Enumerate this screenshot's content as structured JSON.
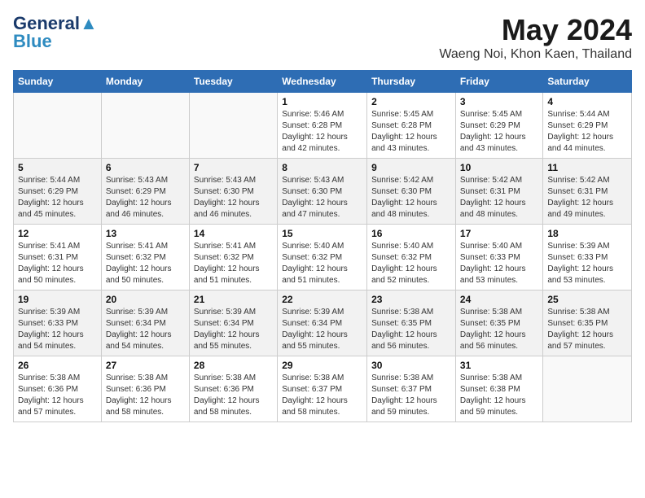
{
  "header": {
    "logo_line1": "General",
    "logo_line2": "Blue",
    "main_title": "May 2024",
    "subtitle": "Waeng Noi, Khon Kaen, Thailand"
  },
  "weekdays": [
    "Sunday",
    "Monday",
    "Tuesday",
    "Wednesday",
    "Thursday",
    "Friday",
    "Saturday"
  ],
  "weeks": [
    [
      {
        "day": "",
        "info": ""
      },
      {
        "day": "",
        "info": ""
      },
      {
        "day": "",
        "info": ""
      },
      {
        "day": "1",
        "info": "Sunrise: 5:46 AM\nSunset: 6:28 PM\nDaylight: 12 hours\nand 42 minutes."
      },
      {
        "day": "2",
        "info": "Sunrise: 5:45 AM\nSunset: 6:28 PM\nDaylight: 12 hours\nand 43 minutes."
      },
      {
        "day": "3",
        "info": "Sunrise: 5:45 AM\nSunset: 6:29 PM\nDaylight: 12 hours\nand 43 minutes."
      },
      {
        "day": "4",
        "info": "Sunrise: 5:44 AM\nSunset: 6:29 PM\nDaylight: 12 hours\nand 44 minutes."
      }
    ],
    [
      {
        "day": "5",
        "info": "Sunrise: 5:44 AM\nSunset: 6:29 PM\nDaylight: 12 hours\nand 45 minutes."
      },
      {
        "day": "6",
        "info": "Sunrise: 5:43 AM\nSunset: 6:29 PM\nDaylight: 12 hours\nand 46 minutes."
      },
      {
        "day": "7",
        "info": "Sunrise: 5:43 AM\nSunset: 6:30 PM\nDaylight: 12 hours\nand 46 minutes."
      },
      {
        "day": "8",
        "info": "Sunrise: 5:43 AM\nSunset: 6:30 PM\nDaylight: 12 hours\nand 47 minutes."
      },
      {
        "day": "9",
        "info": "Sunrise: 5:42 AM\nSunset: 6:30 PM\nDaylight: 12 hours\nand 48 minutes."
      },
      {
        "day": "10",
        "info": "Sunrise: 5:42 AM\nSunset: 6:31 PM\nDaylight: 12 hours\nand 48 minutes."
      },
      {
        "day": "11",
        "info": "Sunrise: 5:42 AM\nSunset: 6:31 PM\nDaylight: 12 hours\nand 49 minutes."
      }
    ],
    [
      {
        "day": "12",
        "info": "Sunrise: 5:41 AM\nSunset: 6:31 PM\nDaylight: 12 hours\nand 50 minutes."
      },
      {
        "day": "13",
        "info": "Sunrise: 5:41 AM\nSunset: 6:32 PM\nDaylight: 12 hours\nand 50 minutes."
      },
      {
        "day": "14",
        "info": "Sunrise: 5:41 AM\nSunset: 6:32 PM\nDaylight: 12 hours\nand 51 minutes."
      },
      {
        "day": "15",
        "info": "Sunrise: 5:40 AM\nSunset: 6:32 PM\nDaylight: 12 hours\nand 51 minutes."
      },
      {
        "day": "16",
        "info": "Sunrise: 5:40 AM\nSunset: 6:32 PM\nDaylight: 12 hours\nand 52 minutes."
      },
      {
        "day": "17",
        "info": "Sunrise: 5:40 AM\nSunset: 6:33 PM\nDaylight: 12 hours\nand 53 minutes."
      },
      {
        "day": "18",
        "info": "Sunrise: 5:39 AM\nSunset: 6:33 PM\nDaylight: 12 hours\nand 53 minutes."
      }
    ],
    [
      {
        "day": "19",
        "info": "Sunrise: 5:39 AM\nSunset: 6:33 PM\nDaylight: 12 hours\nand 54 minutes."
      },
      {
        "day": "20",
        "info": "Sunrise: 5:39 AM\nSunset: 6:34 PM\nDaylight: 12 hours\nand 54 minutes."
      },
      {
        "day": "21",
        "info": "Sunrise: 5:39 AM\nSunset: 6:34 PM\nDaylight: 12 hours\nand 55 minutes."
      },
      {
        "day": "22",
        "info": "Sunrise: 5:39 AM\nSunset: 6:34 PM\nDaylight: 12 hours\nand 55 minutes."
      },
      {
        "day": "23",
        "info": "Sunrise: 5:38 AM\nSunset: 6:35 PM\nDaylight: 12 hours\nand 56 minutes."
      },
      {
        "day": "24",
        "info": "Sunrise: 5:38 AM\nSunset: 6:35 PM\nDaylight: 12 hours\nand 56 minutes."
      },
      {
        "day": "25",
        "info": "Sunrise: 5:38 AM\nSunset: 6:35 PM\nDaylight: 12 hours\nand 57 minutes."
      }
    ],
    [
      {
        "day": "26",
        "info": "Sunrise: 5:38 AM\nSunset: 6:36 PM\nDaylight: 12 hours\nand 57 minutes."
      },
      {
        "day": "27",
        "info": "Sunrise: 5:38 AM\nSunset: 6:36 PM\nDaylight: 12 hours\nand 58 minutes."
      },
      {
        "day": "28",
        "info": "Sunrise: 5:38 AM\nSunset: 6:36 PM\nDaylight: 12 hours\nand 58 minutes."
      },
      {
        "day": "29",
        "info": "Sunrise: 5:38 AM\nSunset: 6:37 PM\nDaylight: 12 hours\nand 58 minutes."
      },
      {
        "day": "30",
        "info": "Sunrise: 5:38 AM\nSunset: 6:37 PM\nDaylight: 12 hours\nand 59 minutes."
      },
      {
        "day": "31",
        "info": "Sunrise: 5:38 AM\nSunset: 6:38 PM\nDaylight: 12 hours\nand 59 minutes."
      },
      {
        "day": "",
        "info": ""
      }
    ]
  ]
}
